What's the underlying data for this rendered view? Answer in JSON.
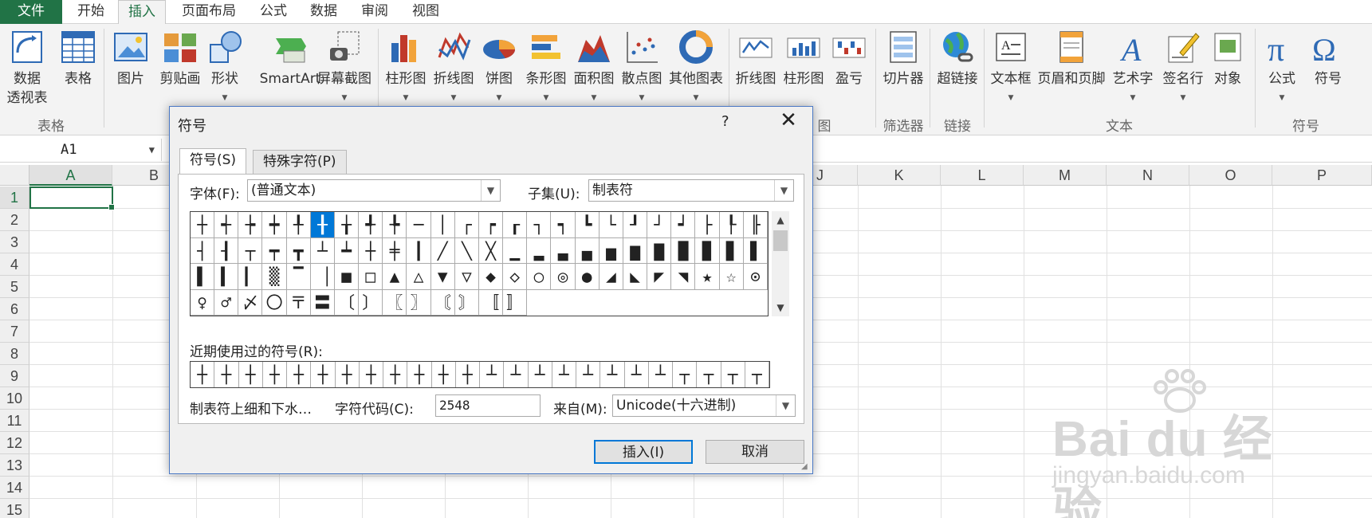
{
  "ribbon_tabs": [
    "文件",
    "开始",
    "插入",
    "页面布局",
    "公式",
    "数据",
    "审阅",
    "视图"
  ],
  "ribbon": {
    "buttons": {
      "pivot_line1": "数据",
      "pivot_line2": "透视表",
      "table": "表格",
      "picture": "图片",
      "clipart": "剪贴画",
      "shapes": "形状",
      "smartart": "SmartArt",
      "screenshot": "屏幕截图",
      "column_chart": "柱形图",
      "line_chart": "折线图",
      "pie_chart": "饼图",
      "bar_chart": "条形图",
      "area_chart": "面积图",
      "scatter_chart": "散点图",
      "other_chart": "其他图表",
      "spark_line": "折线图",
      "spark_column": "柱形图",
      "spark_winloss": "盈亏",
      "slicer": "切片器",
      "hyperlink": "超链接",
      "textbox": "文本框",
      "header_footer": "页眉和页脚",
      "wordart": "艺术字",
      "signature": "签名行",
      "object": "对象",
      "equation": "公式",
      "symbol": "符号"
    },
    "groups": {
      "tables": "表格",
      "charts_partial": "图",
      "filter": "筛选器",
      "links": "链接",
      "text": "文本",
      "symbols": "符号"
    }
  },
  "formula_bar": {
    "name_box": "A1"
  },
  "grid": {
    "columns": [
      "A",
      "B",
      "J",
      "K",
      "L",
      "M",
      "N",
      "O",
      "P"
    ],
    "rows": [
      "1",
      "2",
      "3",
      "4",
      "5",
      "6",
      "7",
      "8",
      "9",
      "10",
      "11",
      "12",
      "13",
      "14",
      "15"
    ]
  },
  "watermark": {
    "logo": "Bai du 经验",
    "url": "jingyan.baidu.com"
  },
  "dialog": {
    "title": "符号",
    "help": "?",
    "close": "✕",
    "tab_symbols": "符号(S)",
    "tab_special": "特殊字符(P)",
    "font_label": "字体(F):",
    "font_value": "(普通文本)",
    "subset_label": "子集(U):",
    "subset_value": "制表符",
    "symbols": [
      "┼",
      "┽",
      "┾",
      "┿",
      "╀",
      "╂",
      "╁",
      "╃",
      "╄",
      "─",
      "│",
      "┌",
      "┍",
      "┎",
      "┐",
      "┑",
      "┗",
      "└",
      "┚",
      "┘",
      "┙",
      "├",
      "┞",
      "╟",
      "┤",
      "┨",
      "┬",
      "┯",
      "┳",
      "┴",
      "┷",
      "┼",
      "╪",
      "┃",
      "╱",
      "╲",
      "╳",
      "▁",
      "▂",
      "▃",
      "▄",
      "▅",
      "▆",
      "▇",
      "█",
      "▉",
      "▊",
      "▋",
      "▌",
      "▍",
      "▎",
      "▒",
      "▔",
      "▕",
      "■",
      "□",
      "▲",
      "△",
      "▼",
      "▽",
      "◆",
      "◇",
      "○",
      "◎",
      "●",
      "◢",
      "◣",
      "◤",
      "◥",
      "★",
      "☆",
      "⊙",
      "♀",
      "♂",
      "〆",
      "〇",
      "〒",
      "〓",
      "〔",
      "〕",
      "〖",
      "〗",
      "〘",
      "〙",
      "〚",
      "〛"
    ],
    "selected_index": 5,
    "recent_label": "近期使用过的符号(R):",
    "recent": [
      "┼",
      "┼",
      "┼",
      "┼",
      "┼",
      "┼",
      "┼",
      "┼",
      "┼",
      "┼",
      "┼",
      "┼",
      "┴",
      "┴",
      "┴",
      "┴",
      "┴",
      "┴",
      "┴",
      "┴",
      "┬",
      "┬",
      "┬",
      "┬"
    ],
    "char_name": "制表符上细和下水…",
    "code_label": "字符代码(C):",
    "code_value": "2548",
    "from_label": "来自(M):",
    "from_value": "Unicode(十六进制)",
    "insert_button": "插入(I)",
    "cancel_button": "取消"
  },
  "colors": {
    "accent": "#217346",
    "dialog_border": "#4a78c4",
    "selection": "#0078d7"
  }
}
